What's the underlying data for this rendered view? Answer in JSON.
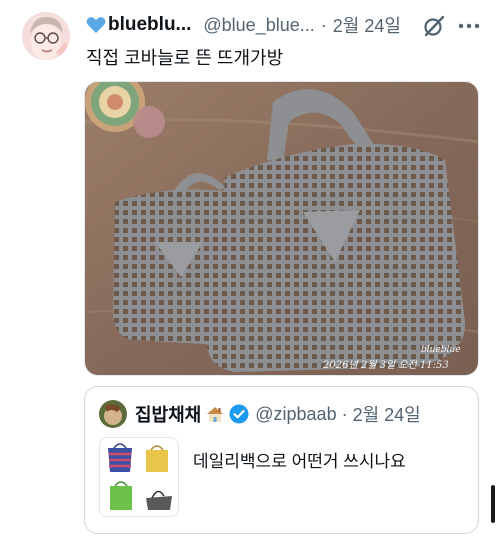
{
  "tweet": {
    "display_name": "blueblu...",
    "handle": "@blue_blue...",
    "separator": "·",
    "date": "2월 24일",
    "text": "직접 코바늘로 뜬 뜨개가방",
    "media": {
      "watermark": "blueblue",
      "timestamp": "2026년 2월 3일 오전 11:53"
    }
  },
  "quote": {
    "display_name": "집밥채채",
    "handle": "@zipbaab",
    "separator": "·",
    "date": "2월 24일",
    "text": "데일리백으로 어떤거 쓰시나요"
  },
  "colors": {
    "text_primary": "#0f1419",
    "text_secondary": "#536471",
    "verified": "#1d9bf0",
    "heart": "#5aa7e6",
    "border": "#cfd9de"
  },
  "icons": [
    "blue-heart-icon",
    "grok-icon",
    "more-icon",
    "house-icon",
    "verified-badge-icon"
  ]
}
